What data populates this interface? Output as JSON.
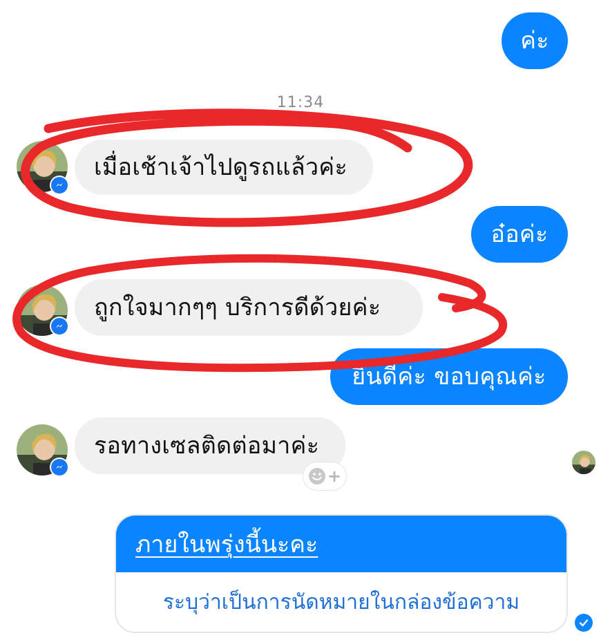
{
  "timestamp": "11:34",
  "messages": [
    {
      "id": "m1",
      "side": "out",
      "text": "ค่ะ"
    },
    {
      "id": "m2",
      "side": "in",
      "text": "เมื่อเช้าเจ้าไปดูรถแล้วค่ะ"
    },
    {
      "id": "m3",
      "side": "out",
      "text": "อ๋อค่ะ"
    },
    {
      "id": "m4",
      "side": "in",
      "text": "ถูกใจมากๆๆ บริการดีด้วยค่ะ"
    },
    {
      "id": "m5",
      "side": "out",
      "text": "ยินดีค่ะ ขอบคุณค่ะ"
    },
    {
      "id": "m6",
      "side": "in",
      "text": "รอทางเซลติดต่อมาค่ะ"
    }
  ],
  "card": {
    "message_text": "ภายในพรุ่งนี้นะคะ",
    "suggestion_text": "ระบุว่าเป็นการนัดหมายในกล่องข้อความ"
  },
  "reaction": {
    "icon": "smiley-add-icon",
    "plus": "+"
  },
  "colors": {
    "outgoing_bubble": "#0a84ff",
    "incoming_bubble": "#f0f0f0",
    "annotation_circle": "#e8282b",
    "messenger_badge": "#1877f2",
    "suggestion_link": "#1f6fd6"
  },
  "icons": {
    "contact_avatar": "contact-avatar",
    "messenger_badge": "messenger-badge-icon",
    "seen_avatar": "seen-avatar",
    "delivered": "delivered-check-icon"
  }
}
